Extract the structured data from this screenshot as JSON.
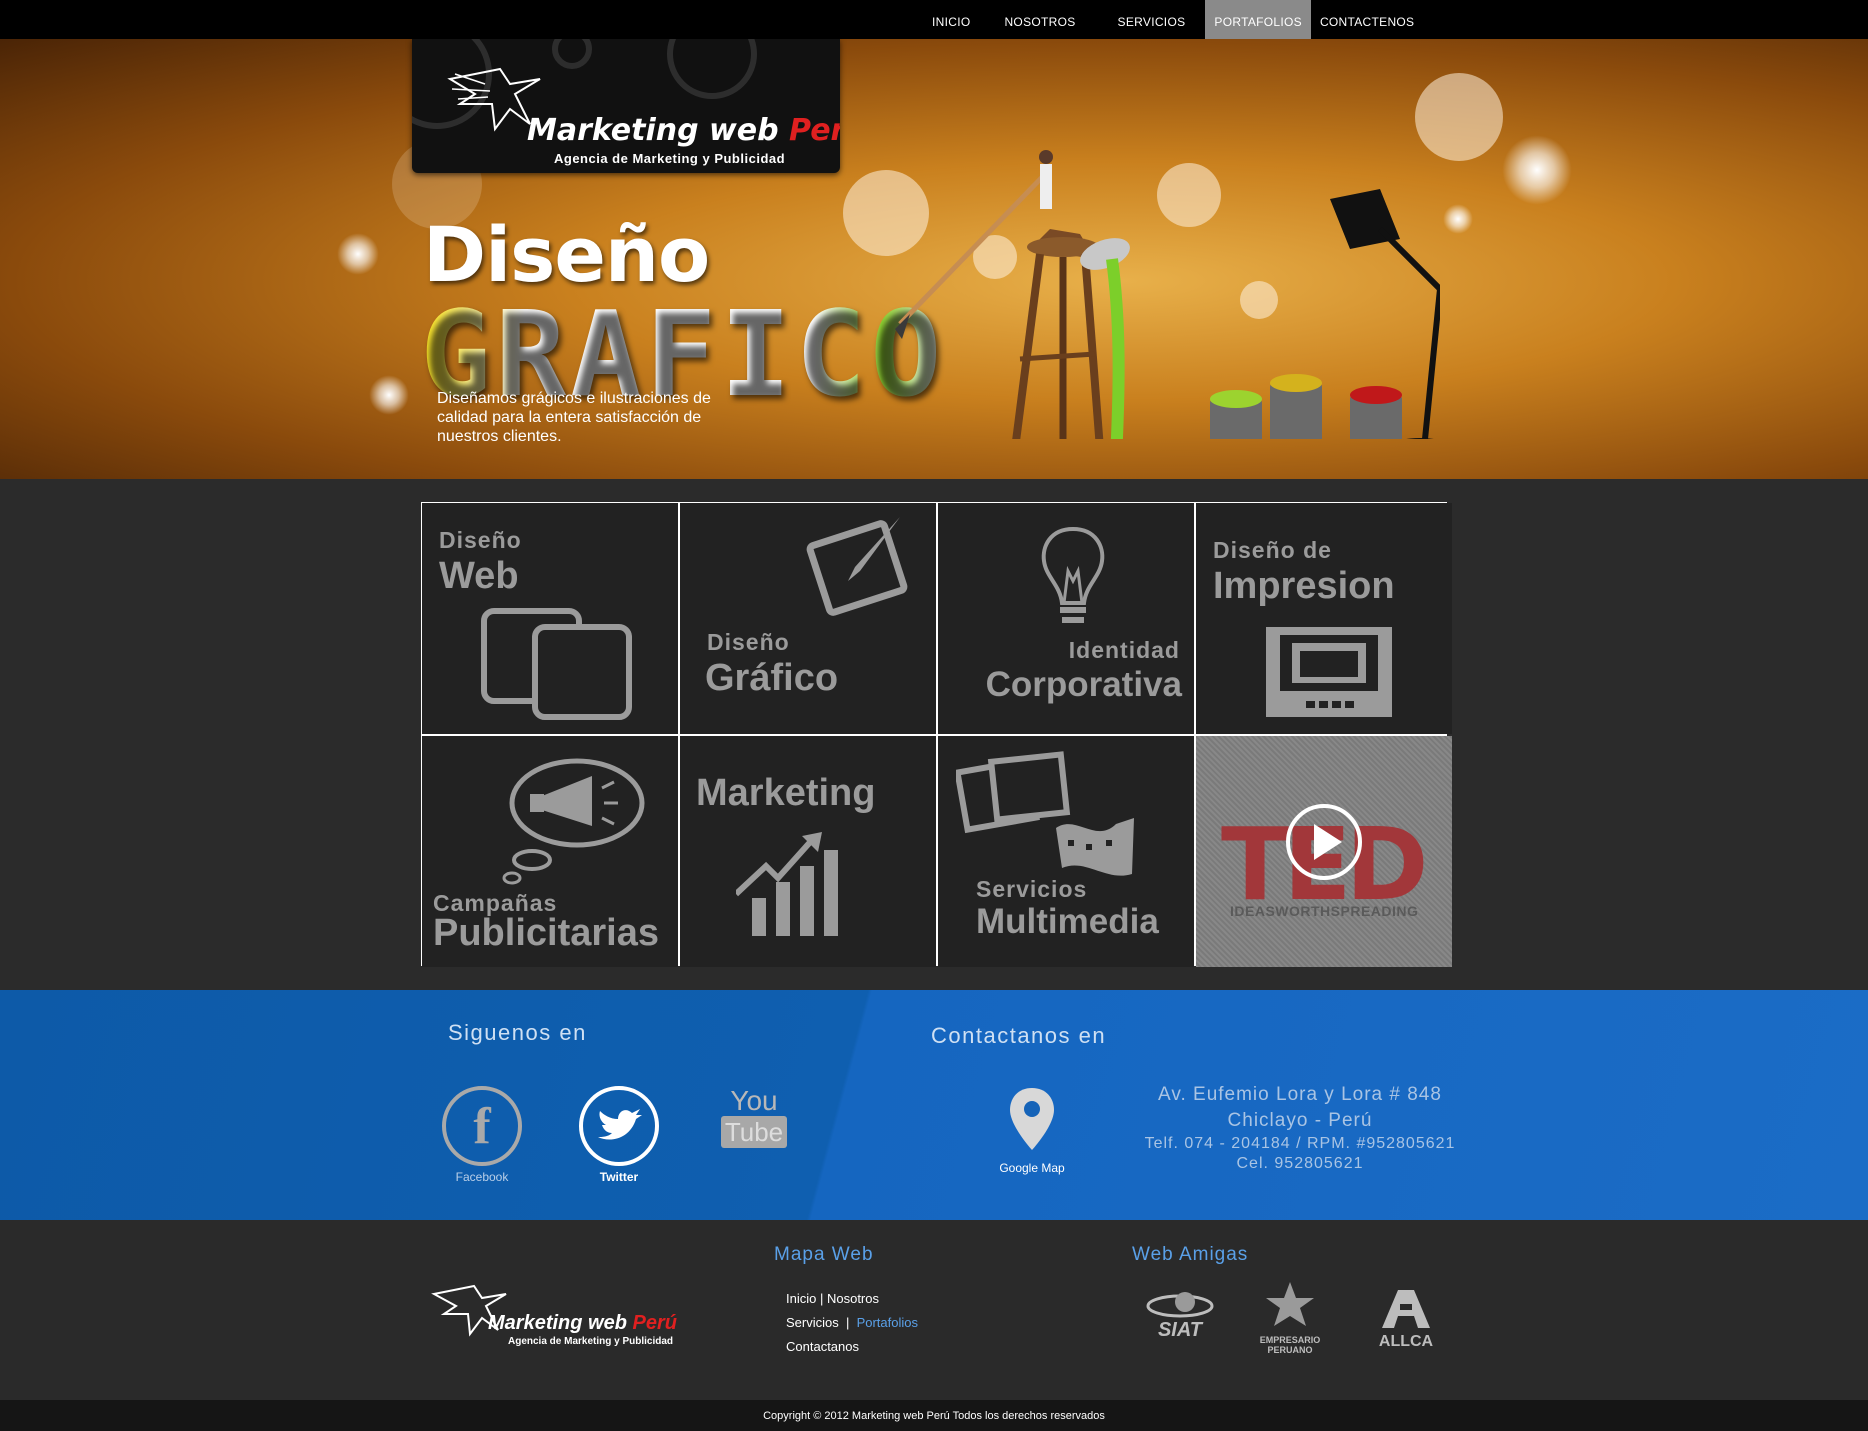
{
  "nav": {
    "items": [
      {
        "label": "INICIO",
        "active": false
      },
      {
        "label": "NOSOTROS",
        "active": false
      },
      {
        "label": "SERVICIOS",
        "active": false
      },
      {
        "label": "PORTAFOLIOS",
        "active": true
      },
      {
        "label": "CONTACTENOS",
        "active": false
      }
    ]
  },
  "logo": {
    "name_part1": "Marketing web ",
    "name_part2": "Perú",
    "tagline": "Agencia de Marketing y Publicidad"
  },
  "hero": {
    "title_line1": "Diseño",
    "title_line2": "GRAFICO",
    "description": "Diseñamos grágicos e ilustraciones de calidad para la entera satisfacción de nuestros clientes."
  },
  "tiles": [
    {
      "small": "Diseño",
      "large": "Web",
      "icon": "window-stack-icon"
    },
    {
      "small": "Diseño",
      "large": "Gráfico",
      "icon": "canvas-brush-icon"
    },
    {
      "small": "Identidad",
      "large": "Corporativa",
      "icon": "lightbulb-icon"
    },
    {
      "small": "Diseño de",
      "large": "Impresion",
      "icon": "printer-icon"
    },
    {
      "small": "Campañas",
      "large": "Publicitarias",
      "icon": "megaphone-bubble-icon"
    },
    {
      "small": "",
      "large": "Marketing",
      "icon": "growth-chart-icon"
    },
    {
      "small": "Servicios",
      "large": "Multimedia",
      "icon": "photo-film-icon"
    },
    {
      "word": "TED",
      "sub": "IDEASWORTHSPREADING",
      "icon": "play-icon"
    }
  ],
  "social": {
    "heading": "Siguenos en",
    "items": [
      {
        "label": "Facebook",
        "icon": "facebook-icon"
      },
      {
        "label": "Twitter",
        "icon": "twitter-icon"
      },
      {
        "label_top": "You",
        "label_bottom": "Tube",
        "icon": "youtube-icon"
      }
    ]
  },
  "contact": {
    "heading": "Contactanos en",
    "map_label": "Google Map",
    "address1": "Av. Eufemio Lora y Lora # 848",
    "address2": "Chiclayo - Perú",
    "phone": "Telf. 074 - 204184 / RPM. #952805621",
    "cell": "Cel. 952805621"
  },
  "footer": {
    "map_heading": "Mapa Web",
    "links": {
      "inicio": "Inicio",
      "sep1": " | ",
      "nosotros": "Nosotros",
      "servicios": "Servicios",
      "sep2": "  |  ",
      "portafolios": "Portafolios",
      "contactanos": "Contactanos"
    },
    "friends_heading": "Web Amigas",
    "friends": [
      {
        "label": "SIAT"
      },
      {
        "label": "EMPRESARIO PERUANO"
      },
      {
        "label": "ALLCA"
      }
    ],
    "copyright": "Copyright © 2012   Marketing web Perú Todos los derechos reservados"
  }
}
